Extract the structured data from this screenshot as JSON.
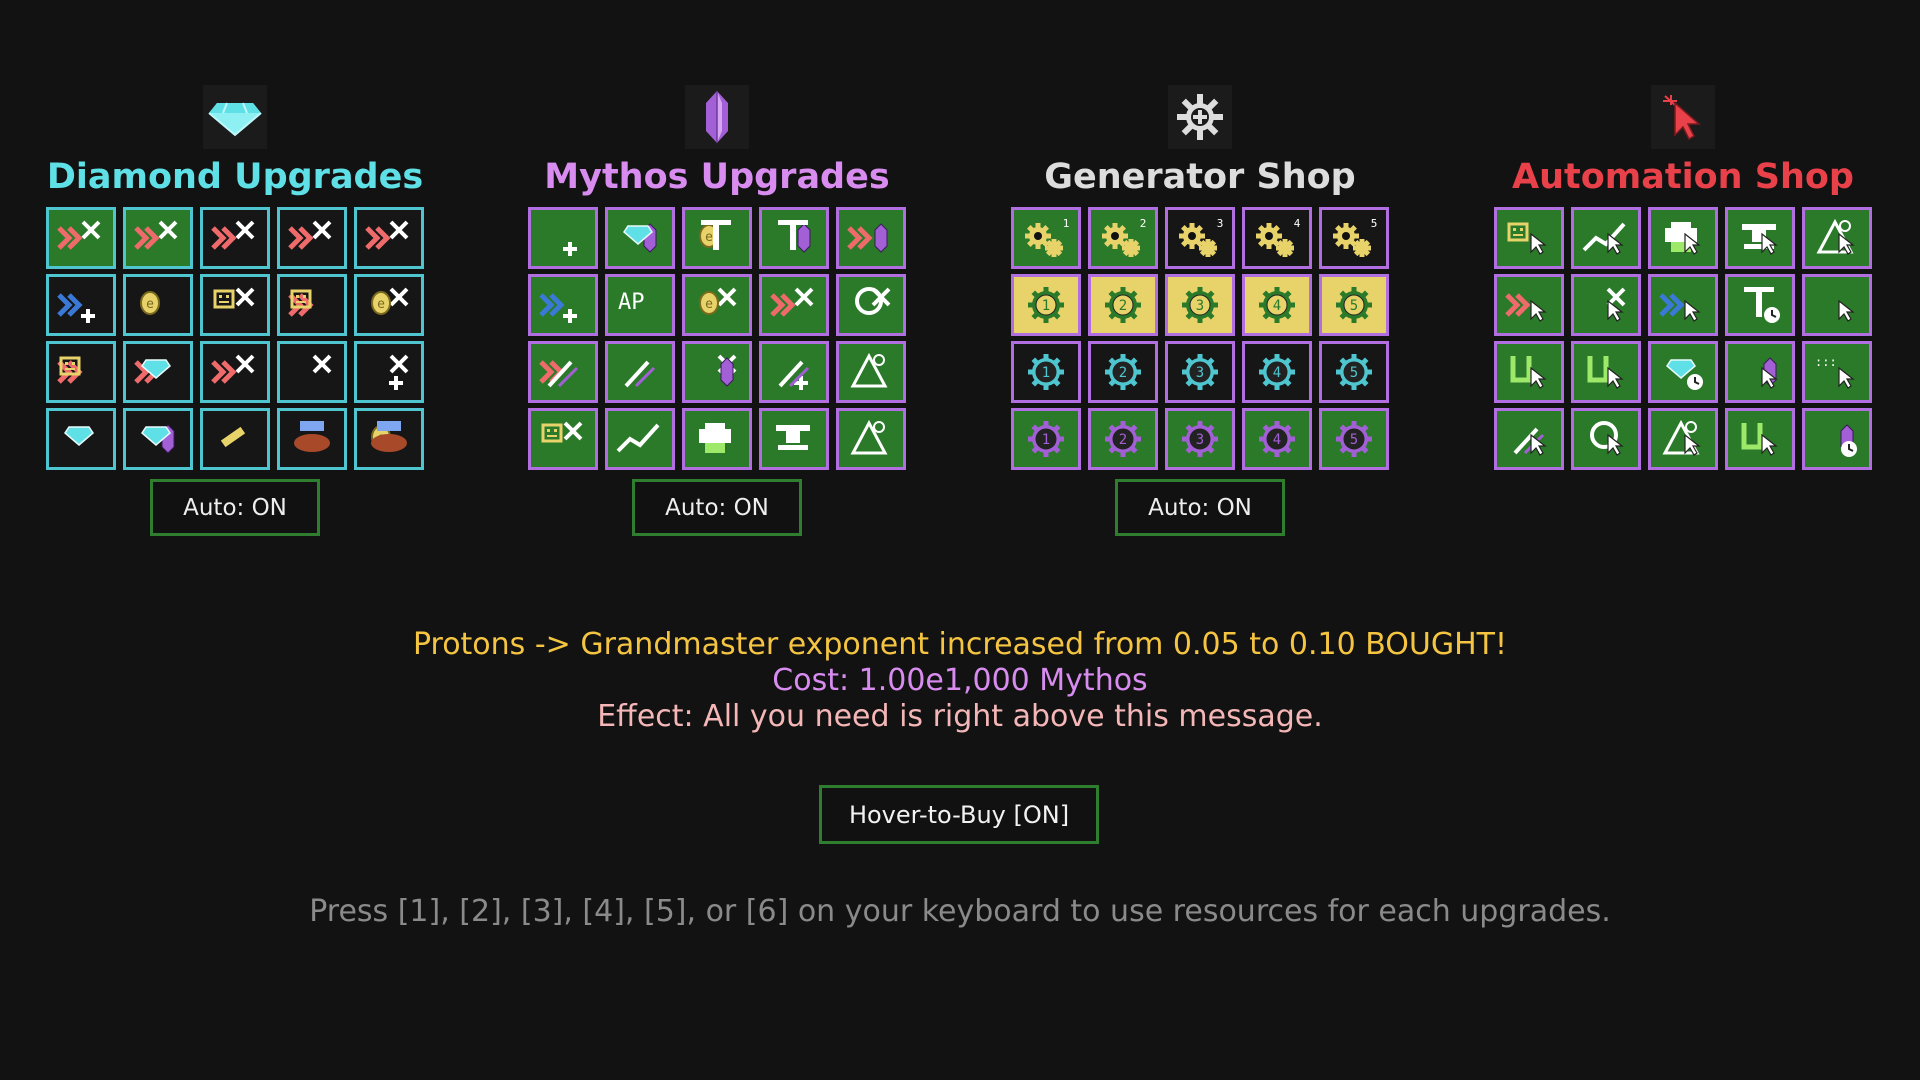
{
  "colors": {
    "background": "#121212",
    "diamond": "#5fe0e6",
    "mythos": "#d88cf0",
    "generator": "#dddddd",
    "automation": "#e8414a",
    "bought_green": "#2a7a2a",
    "effect_message": "#f5c542",
    "cost_message": "#d88cf0",
    "effect_text": "#f4b6b6",
    "hint": "#8a8a8a"
  },
  "panels": [
    {
      "id": "diamond",
      "title": "Diamond Upgrades",
      "icon": "diamond-icon",
      "title_color": "#5fe0e6",
      "cell_border": "#4fc6cf",
      "auto_label": "Auto: ON",
      "cells": [
        {
          "icon": "chevron-x-icon",
          "bg": "#2a7a2a"
        },
        {
          "icon": "chevron-x-icon",
          "bg": "#2a7a2a"
        },
        {
          "icon": "chevron-x-icon",
          "bg": "#161616"
        },
        {
          "icon": "chevron-x-icon",
          "bg": "#161616"
        },
        {
          "icon": "chevron-x-icon",
          "bg": "#161616"
        },
        {
          "icon": "chevron-plus-icon",
          "bg": "#161616"
        },
        {
          "icon": "coin-icon",
          "bg": "#161616"
        },
        {
          "icon": "robot-x-icon",
          "bg": "#161616"
        },
        {
          "icon": "robot-chevron-icon",
          "bg": "#161616"
        },
        {
          "icon": "coin-x-icon",
          "bg": "#161616"
        },
        {
          "icon": "robot-chevron-icon",
          "bg": "#161616"
        },
        {
          "icon": "gem-chevron-icon",
          "bg": "#161616"
        },
        {
          "icon": "x-chevron-icon",
          "bg": "#161616"
        },
        {
          "icon": "x-icon",
          "bg": "#161616"
        },
        {
          "icon": "x-plus-icon",
          "bg": "#161616"
        },
        {
          "icon": "stack-gem-icon",
          "bg": "#161616"
        },
        {
          "icon": "gem-crystal-icon",
          "bg": "#161616"
        },
        {
          "icon": "bone-icon",
          "bg": "#161616"
        },
        {
          "icon": "bug-icon",
          "bg": "#161616"
        },
        {
          "icon": "bug-coin-icon",
          "bg": "#161616"
        }
      ]
    },
    {
      "id": "mythos",
      "title": "Mythos Upgrades",
      "icon": "crystal-icon",
      "title_color": "#d88cf0",
      "cell_border": "#b06ee0",
      "auto_label": "Auto: ON",
      "cells": [
        {
          "icon": "plus-icon",
          "bg": "#2a7a2a"
        },
        {
          "icon": "gem-crystal-icon",
          "bg": "#2a7a2a"
        },
        {
          "icon": "t-coin-icon",
          "bg": "#2a7a2a"
        },
        {
          "icon": "t-crystal-icon",
          "bg": "#2a7a2a"
        },
        {
          "icon": "chevron-crystal-icon",
          "bg": "#2a7a2a"
        },
        {
          "icon": "chevron-plus-icon",
          "bg": "#2a7a2a"
        },
        {
          "icon": "ap-icon",
          "bg": "#2a7a2a"
        },
        {
          "icon": "coin-x-icon",
          "bg": "#2a7a2a"
        },
        {
          "icon": "x-chevron-icon",
          "bg": "#2a7a2a"
        },
        {
          "icon": "c-x-icon",
          "bg": "#2a7a2a"
        },
        {
          "icon": "wand-chevron-icon",
          "bg": "#2a7a2a"
        },
        {
          "icon": "wand-icon",
          "bg": "#2a7a2a"
        },
        {
          "icon": "crystal-x-icon",
          "bg": "#2a7a2a"
        },
        {
          "icon": "wand-plus-icon",
          "bg": "#2a7a2a"
        },
        {
          "icon": "flask-icon",
          "bg": "#2a7a2a"
        },
        {
          "icon": "robot-x-icon",
          "bg": "#2a7a2a"
        },
        {
          "icon": "trend-icon",
          "bg": "#2a7a2a"
        },
        {
          "icon": "printer-icon",
          "bg": "#2a7a2a"
        },
        {
          "icon": "anvil-icon",
          "bg": "#2a7a2a"
        },
        {
          "icon": "hat-icon",
          "bg": "#2a7a2a"
        }
      ]
    },
    {
      "id": "generator",
      "title": "Generator Shop",
      "icon": "gear-plus-icon",
      "title_color": "#dddddd",
      "cell_border": "#b06ee0",
      "auto_label": "Auto: ON",
      "cells": [
        {
          "icon": "gears-icon",
          "num": "1",
          "bg": "#2a7a2a",
          "gear": "#e8d36a"
        },
        {
          "icon": "gears-icon",
          "num": "2",
          "bg": "#2a7a2a",
          "gear": "#e8d36a"
        },
        {
          "icon": "gears-icon",
          "num": "3",
          "bg": "#161616",
          "gear": "#e8d36a"
        },
        {
          "icon": "gears-icon",
          "num": "4",
          "bg": "#161616",
          "gear": "#e8d36a"
        },
        {
          "icon": "gears-icon",
          "num": "5",
          "bg": "#161616",
          "gear": "#e8d36a"
        },
        {
          "icon": "gear-num-icon",
          "num": "1",
          "bg": "#e8d36a",
          "gear": "#2a7a2a"
        },
        {
          "icon": "gear-num-icon",
          "num": "2",
          "bg": "#e8d36a",
          "gear": "#2a7a2a"
        },
        {
          "icon": "gear-num-icon",
          "num": "3",
          "bg": "#e8d36a",
          "gear": "#2a7a2a"
        },
        {
          "icon": "gear-num-icon",
          "num": "4",
          "bg": "#e8d36a",
          "gear": "#2a7a2a"
        },
        {
          "icon": "gear-num-icon",
          "num": "5",
          "bg": "#e8d36a",
          "gear": "#2a7a2a"
        },
        {
          "icon": "gear-num-icon",
          "num": "1",
          "bg": "#161616",
          "gear": "#4fc6cf"
        },
        {
          "icon": "gear-num-icon",
          "num": "2",
          "bg": "#161616",
          "gear": "#4fc6cf"
        },
        {
          "icon": "gear-num-icon",
          "num": "3",
          "bg": "#161616",
          "gear": "#4fc6cf"
        },
        {
          "icon": "gear-num-icon",
          "num": "4",
          "bg": "#161616",
          "gear": "#4fc6cf"
        },
        {
          "icon": "gear-num-icon",
          "num": "5",
          "bg": "#161616",
          "gear": "#4fc6cf"
        },
        {
          "icon": "gear-num-icon",
          "num": "1",
          "bg": "#2a7a2a",
          "gear": "#a35fd6"
        },
        {
          "icon": "gear-num-icon",
          "num": "2",
          "bg": "#2a7a2a",
          "gear": "#a35fd6"
        },
        {
          "icon": "gear-num-icon",
          "num": "3",
          "bg": "#2a7a2a",
          "gear": "#a35fd6"
        },
        {
          "icon": "gear-num-icon",
          "num": "4",
          "bg": "#2a7a2a",
          "gear": "#a35fd6"
        },
        {
          "icon": "gear-num-icon",
          "num": "5",
          "bg": "#2a7a2a",
          "gear": "#a35fd6"
        }
      ]
    },
    {
      "id": "automation",
      "title": "Automation Shop",
      "icon": "cursor-icon",
      "title_color": "#e8414a",
      "cell_border": "#b06ee0",
      "auto_label": "",
      "cells": [
        {
          "icon": "robot-cursor-icon",
          "bg": "#2a7a2a"
        },
        {
          "icon": "trend-cursor-icon",
          "bg": "#2a7a2a"
        },
        {
          "icon": "printer-cursor-icon",
          "bg": "#2a7a2a"
        },
        {
          "icon": "anvil-cursor-icon",
          "bg": "#2a7a2a"
        },
        {
          "icon": "hat-cursor-icon",
          "bg": "#2a7a2a"
        },
        {
          "icon": "chevron-cursor-icon",
          "bg": "#2a7a2a"
        },
        {
          "icon": "x-cursor-icon",
          "bg": "#2a7a2a"
        },
        {
          "icon": "blue-chevron-cursor-icon",
          "bg": "#2a7a2a"
        },
        {
          "icon": "t-refresh-icon",
          "bg": "#2a7a2a"
        },
        {
          "icon": "gear-cursor-icon",
          "bg": "#2a7a2a"
        },
        {
          "icon": "u-cursor-icon",
          "bg": "#2a7a2a"
        },
        {
          "icon": "u-cursor-icon",
          "bg": "#2a7a2a"
        },
        {
          "icon": "gem-clock-icon",
          "bg": "#2a7a2a"
        },
        {
          "icon": "crystal-cursor-icon",
          "bg": "#2a7a2a"
        },
        {
          "icon": "dots-cursor-icon",
          "bg": "#2a7a2a"
        },
        {
          "icon": "wand-cursor-icon",
          "bg": "#2a7a2a"
        },
        {
          "icon": "c-cursor-icon",
          "bg": "#2a7a2a"
        },
        {
          "icon": "hat-cursor-icon",
          "bg": "#2a7a2a"
        },
        {
          "icon": "u-cursor-icon",
          "bg": "#2a7a2a"
        },
        {
          "icon": "crystal-clock-icon",
          "bg": "#2a7a2a"
        }
      ]
    }
  ],
  "message": {
    "line1": "Protons -> Grandmaster exponent increased from 0.05 to 0.10 BOUGHT!",
    "line2": "Cost: 1.00e1,000 Mythos",
    "line3": "Effect: All you need is right above this message."
  },
  "hover_button": "Hover-to-Buy [ON]",
  "hint": "Press [1], [2], [3], [4], [5], or [6] on your keyboard to use resources for each upgrades."
}
